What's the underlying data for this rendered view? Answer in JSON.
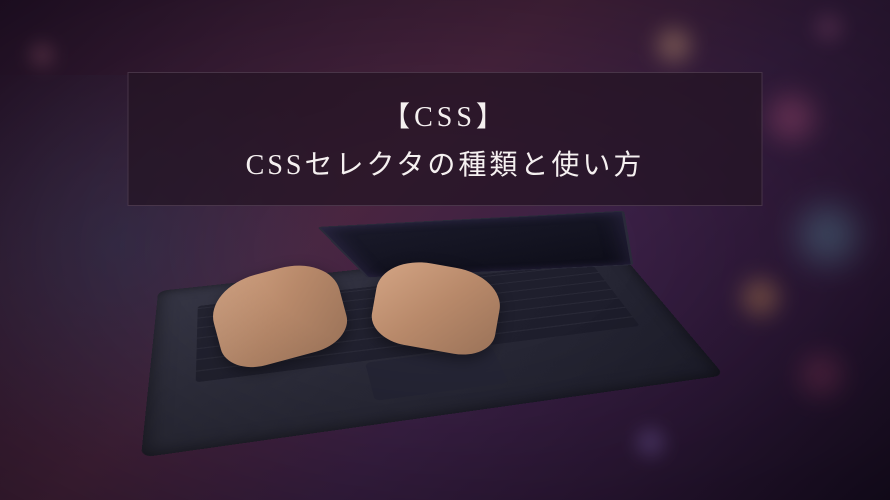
{
  "title": {
    "category": "【CSS】",
    "main": "CSSセレクタの種類と使い方"
  },
  "image": {
    "description": "Person typing on laptop keyboard in dim purple/magenta lighting with bokeh lights in background"
  }
}
